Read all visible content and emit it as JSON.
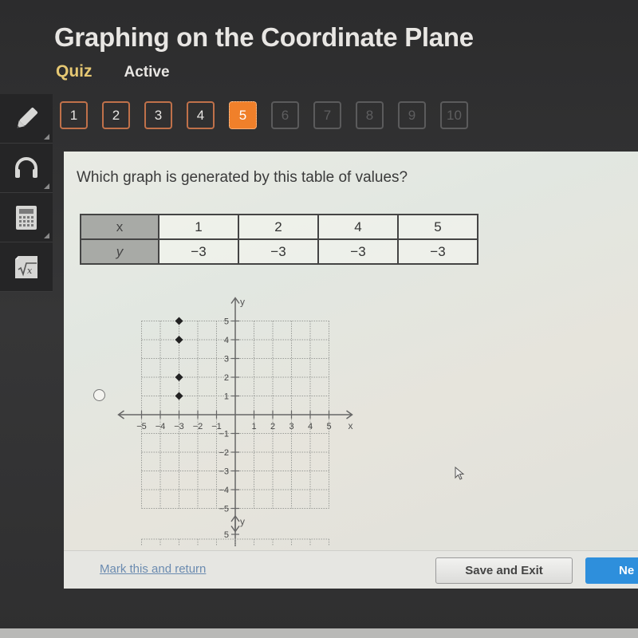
{
  "header": {
    "title": "Graphing on the Coordinate Plane",
    "section": "Quiz",
    "status": "Active"
  },
  "colors": {
    "accent": "#f0802a",
    "section_label": "#e6c873",
    "next_button": "#2e8fdc",
    "link": "#6b8bb0"
  },
  "sidebar": {
    "tools": [
      {
        "name": "pencil",
        "icon": "pencil-icon"
      },
      {
        "name": "audio",
        "icon": "headphones-icon"
      },
      {
        "name": "calculator",
        "icon": "calculator-icon"
      },
      {
        "name": "formula",
        "icon": "square-root-icon"
      }
    ]
  },
  "question_nav": {
    "current": 5,
    "items": [
      {
        "label": "1",
        "state": "answered"
      },
      {
        "label": "2",
        "state": "answered"
      },
      {
        "label": "3",
        "state": "answered"
      },
      {
        "label": "4",
        "state": "answered"
      },
      {
        "label": "5",
        "state": "current"
      },
      {
        "label": "6",
        "state": "disabled"
      },
      {
        "label": "7",
        "state": "disabled"
      },
      {
        "label": "8",
        "state": "disabled"
      },
      {
        "label": "9",
        "state": "disabled"
      },
      {
        "label": "10",
        "state": "disabled"
      }
    ]
  },
  "question": {
    "prompt": "Which graph is generated by this table of values?",
    "table": {
      "row_headers": [
        "x",
        "y"
      ],
      "x": [
        "1",
        "2",
        "4",
        "5"
      ],
      "y": [
        "−3",
        "−3",
        "−3",
        "−3"
      ]
    }
  },
  "chart_data": {
    "type": "scatter",
    "title": "",
    "xlabel": "x",
    "ylabel": "y",
    "xlim": [
      -5,
      5
    ],
    "ylim": [
      -5,
      5
    ],
    "grid": true,
    "x_ticks": [
      "−5",
      "−4",
      "−3",
      "−2",
      "−1",
      "1",
      "2",
      "3",
      "4",
      "5"
    ],
    "y_ticks": [
      "5",
      "4",
      "3",
      "2",
      "1",
      "−1",
      "−2",
      "−3",
      "−4",
      "−5"
    ],
    "points": [
      {
        "x": -3,
        "y": 5
      },
      {
        "x": -3,
        "y": 4
      },
      {
        "x": -3,
        "y": 2
      },
      {
        "x": -3,
        "y": 1
      }
    ]
  },
  "next_graph_preview": {
    "ylabel": "y",
    "top_tick": "5"
  },
  "footer": {
    "mark_link": "Mark this and return",
    "save_label": "Save and Exit",
    "next_label": "Ne"
  }
}
